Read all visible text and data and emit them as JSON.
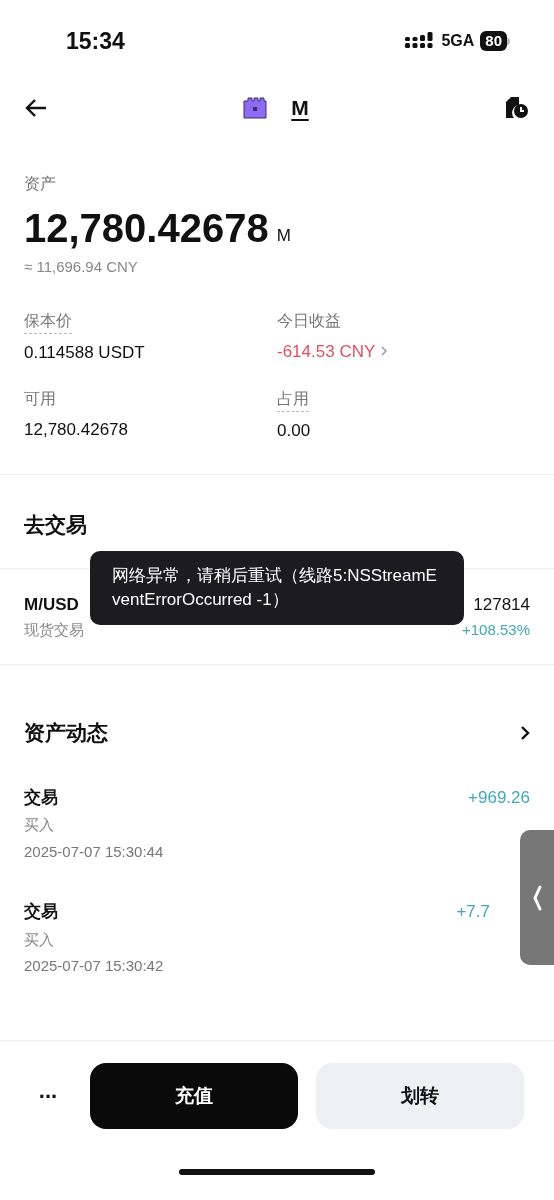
{
  "status_bar": {
    "time": "15:34",
    "network": "5GA",
    "battery": "80"
  },
  "nav": {
    "title": "M"
  },
  "assets": {
    "label": "资产",
    "amount": "12,780.42678",
    "unit": "M",
    "approx": "≈ 11,696.94 CNY",
    "stats": [
      {
        "label": "保本价",
        "value": "0.114588 USDT",
        "kind": "plain",
        "dashed": true
      },
      {
        "label": "今日收益",
        "value": "-614.53 CNY",
        "kind": "link",
        "dashed": false
      },
      {
        "label": "可用",
        "value": "12,780.42678",
        "kind": "plain",
        "dashed": false
      },
      {
        "label": "占用",
        "value": "0.00",
        "kind": "plain",
        "dashed": true
      }
    ]
  },
  "trade": {
    "title": "去交易",
    "pair": "M/USD",
    "type": "现货交易",
    "price": "127814",
    "change": "+108.53%"
  },
  "toast": {
    "text": "网络异常，请稍后重试（线路5:NSStreamEventErrorOccurred -1）"
  },
  "activity": {
    "title": "资产动态",
    "rows": [
      {
        "title": "交易",
        "action": "买入",
        "time": "2025-07-07 15:30:44",
        "amount": "+969.26"
      },
      {
        "title": "交易",
        "action": "买入",
        "time": "2025-07-07 15:30:42",
        "amount": "+7.7"
      }
    ]
  },
  "actions": {
    "more": "...",
    "primary": "充值",
    "secondary": "划转"
  }
}
